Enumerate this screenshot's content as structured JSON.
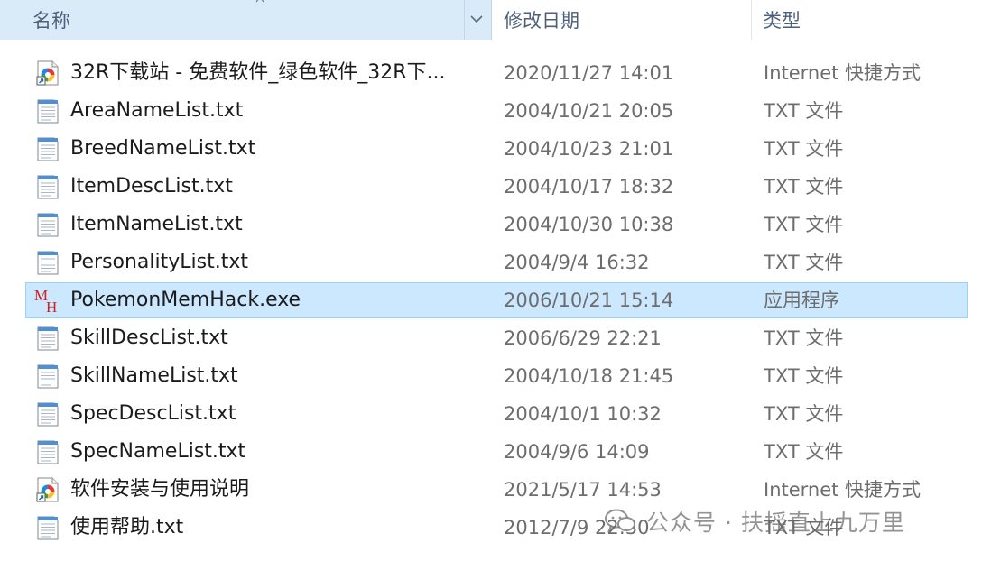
{
  "columns": {
    "name": "名称",
    "date": "修改日期",
    "type": "类型"
  },
  "files": [
    {
      "name": "32R下载站 - 免费软件_绿色软件_32R下...",
      "date": "2020/11/27 14:01",
      "type": "Internet 快捷方式",
      "icon": "internet-shortcut-icon"
    },
    {
      "name": "AreaNameList.txt",
      "date": "2004/10/21 20:05",
      "type": "TXT 文件",
      "icon": "txt-file-icon"
    },
    {
      "name": "BreedNameList.txt",
      "date": "2004/10/23 21:01",
      "type": "TXT 文件",
      "icon": "txt-file-icon"
    },
    {
      "name": "ItemDescList.txt",
      "date": "2004/10/17 18:32",
      "type": "TXT 文件",
      "icon": "txt-file-icon"
    },
    {
      "name": "ItemNameList.txt",
      "date": "2004/10/30 10:38",
      "type": "TXT 文件",
      "icon": "txt-file-icon"
    },
    {
      "name": "PersonalityList.txt",
      "date": "2004/9/4 16:32",
      "type": "TXT 文件",
      "icon": "txt-file-icon"
    },
    {
      "name": "PokemonMemHack.exe",
      "date": "2006/10/21 15:14",
      "type": "应用程序",
      "icon": "mh-app-icon",
      "selected": true
    },
    {
      "name": "SkillDescList.txt",
      "date": "2006/6/29 22:21",
      "type": "TXT 文件",
      "icon": "txt-file-icon"
    },
    {
      "name": "SkillNameList.txt",
      "date": "2004/10/18 21:45",
      "type": "TXT 文件",
      "icon": "txt-file-icon"
    },
    {
      "name": "SpecDescList.txt",
      "date": "2004/10/1 10:32",
      "type": "TXT 文件",
      "icon": "txt-file-icon"
    },
    {
      "name": "SpecNameList.txt",
      "date": "2004/9/6 14:09",
      "type": "TXT 文件",
      "icon": "txt-file-icon"
    },
    {
      "name": "软件安装与使用说明",
      "date": "2021/5/17 14:53",
      "type": "Internet 快捷方式",
      "icon": "internet-shortcut-icon"
    },
    {
      "name": "使用帮助.txt",
      "date": "2012/7/9 22:30",
      "type": "TXT 文件",
      "icon": "txt-file-icon"
    }
  ],
  "exe_icon_letters": [
    "M",
    "H"
  ],
  "watermark": {
    "text": "公众号 · 扶摇直上九万里"
  },
  "colors": {
    "selected_bg": "#cce8ff",
    "selected_border": "#99d1ff",
    "header_active_bg": "#d9ebf9",
    "exe_icon_red": "#d42020"
  }
}
